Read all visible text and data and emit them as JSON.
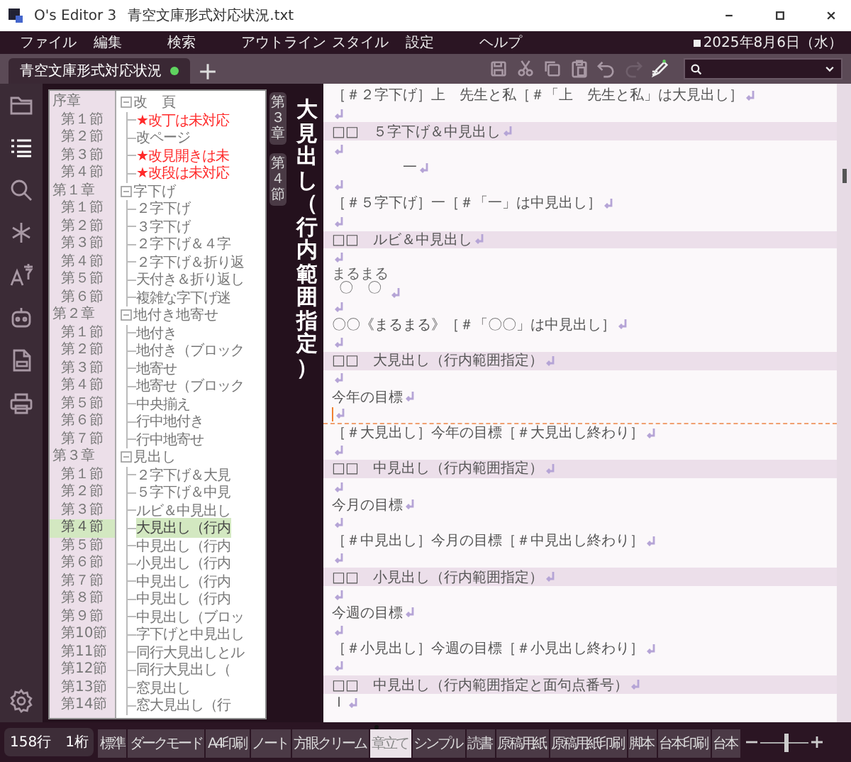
{
  "window": {
    "app": "O's Editor 3",
    "file": "青空文庫形式対応状況.txt"
  },
  "menu": [
    "ファイル",
    "編集",
    "検索",
    "アウトライン",
    "スタイル",
    "設定",
    "ヘルプ"
  ],
  "date": "2025年8月6日（水）",
  "tabs": [
    {
      "label": "青空文庫形式対応状況",
      "selected": true,
      "modified": true
    }
  ],
  "toolbar": [
    {
      "kind": "save",
      "disabled": false
    },
    {
      "kind": "cut",
      "disabled": false
    },
    {
      "kind": "copy",
      "disabled": false
    },
    {
      "kind": "paste",
      "disabled": false
    },
    {
      "kind": "undo",
      "disabled": false
    },
    {
      "kind": "redo",
      "disabled": true
    },
    {
      "kind": "pen",
      "disabled": false
    }
  ],
  "sidebar_icons": [
    {
      "kind": "folder",
      "selected": false
    },
    {
      "kind": "outline",
      "selected": true
    },
    {
      "kind": "search",
      "selected": false
    },
    {
      "kind": "asterisk",
      "selected": false
    },
    {
      "kind": "font",
      "selected": false
    },
    {
      "kind": "robot",
      "selected": false
    },
    {
      "kind": "document",
      "selected": false
    },
    {
      "kind": "printer",
      "selected": false
    },
    {
      "kind": "settings",
      "selected": false
    }
  ],
  "outline": {
    "chapters": [
      {
        "label": "序章",
        "kind": "chapter",
        "selected": false
      },
      {
        "label": "第１節",
        "kind": "section",
        "selected": false
      },
      {
        "label": "第２節",
        "kind": "section",
        "selected": false
      },
      {
        "label": "第３節",
        "kind": "section",
        "selected": false
      },
      {
        "label": "第４節",
        "kind": "section",
        "selected": false
      },
      {
        "label": "第１章",
        "kind": "chapter",
        "selected": false
      },
      {
        "label": "第１節",
        "kind": "section",
        "selected": false
      },
      {
        "label": "第２節",
        "kind": "section",
        "selected": false
      },
      {
        "label": "第３節",
        "kind": "section",
        "selected": false
      },
      {
        "label": "第４節",
        "kind": "section",
        "selected": false
      },
      {
        "label": "第５節",
        "kind": "section",
        "selected": false
      },
      {
        "label": "第６節",
        "kind": "section",
        "selected": false
      },
      {
        "label": "第２章",
        "kind": "chapter",
        "selected": false
      },
      {
        "label": "第１節",
        "kind": "section",
        "selected": false
      },
      {
        "label": "第２節",
        "kind": "section",
        "selected": false
      },
      {
        "label": "第３節",
        "kind": "section",
        "selected": false
      },
      {
        "label": "第４節",
        "kind": "section",
        "selected": false
      },
      {
        "label": "第５節",
        "kind": "section",
        "selected": false
      },
      {
        "label": "第６節",
        "kind": "section",
        "selected": false
      },
      {
        "label": "第７節",
        "kind": "section",
        "selected": false
      },
      {
        "label": "第３章",
        "kind": "chapter",
        "selected": false
      },
      {
        "label": "第１節",
        "kind": "section",
        "selected": false
      },
      {
        "label": "第２節",
        "kind": "section",
        "selected": false
      },
      {
        "label": "第３節",
        "kind": "section",
        "selected": false
      },
      {
        "label": "第４節",
        "kind": "section",
        "selected": true
      },
      {
        "label": "第５節",
        "kind": "section",
        "selected": false
      },
      {
        "label": "第６節",
        "kind": "section",
        "selected": false
      },
      {
        "label": "第７節",
        "kind": "section",
        "selected": false
      },
      {
        "label": "第８節",
        "kind": "section",
        "selected": false
      },
      {
        "label": "第９節",
        "kind": "section",
        "selected": false
      },
      {
        "label": "第10節",
        "kind": "section",
        "selected": false
      },
      {
        "label": "第11節",
        "kind": "section",
        "selected": false
      },
      {
        "label": "第12節",
        "kind": "section",
        "selected": false
      },
      {
        "label": "第13節",
        "kind": "section",
        "selected": false
      },
      {
        "label": "第14節",
        "kind": "section",
        "selected": false
      }
    ],
    "tree": [
      {
        "label": "改　頁",
        "expanded": true,
        "children": [
          {
            "label": "★改丁は未対応",
            "flagged": true,
            "selected": false
          },
          {
            "label": "改ページ",
            "flagged": false,
            "selected": false
          },
          {
            "label": "★改見開きは未",
            "flagged": true,
            "selected": false
          },
          {
            "label": "★改段は未対応",
            "flagged": true,
            "selected": false
          }
        ]
      },
      {
        "label": "字下げ",
        "expanded": true,
        "children": [
          {
            "label": "２字下げ",
            "flagged": false,
            "selected": false
          },
          {
            "label": "３字下げ",
            "flagged": false,
            "selected": false
          },
          {
            "label": "２字下げ＆４字",
            "flagged": false,
            "selected": false
          },
          {
            "label": "２字下げ＆折り返",
            "flagged": false,
            "selected": false
          },
          {
            "label": "天付き＆折り返し",
            "flagged": false,
            "selected": false
          },
          {
            "label": "複雑な字下げ迷",
            "flagged": false,
            "selected": false
          }
        ]
      },
      {
        "label": "地付き地寄せ",
        "expanded": true,
        "children": [
          {
            "label": "地付き",
            "flagged": false,
            "selected": false
          },
          {
            "label": "地付き（ブロック",
            "flagged": false,
            "selected": false
          },
          {
            "label": "地寄せ",
            "flagged": false,
            "selected": false
          },
          {
            "label": "地寄せ（ブロック",
            "flagged": false,
            "selected": false
          },
          {
            "label": "中央揃え",
            "flagged": false,
            "selected": false
          },
          {
            "label": "行中地付き",
            "flagged": false,
            "selected": false
          },
          {
            "label": "行中地寄せ",
            "flagged": false,
            "selected": false
          }
        ]
      },
      {
        "label": "見出し",
        "expanded": true,
        "children": [
          {
            "label": "２字下げ＆大見",
            "flagged": false,
            "selected": false
          },
          {
            "label": "５字下げ＆中見",
            "flagged": false,
            "selected": false
          },
          {
            "label": "ルビ＆中見出し",
            "flagged": false,
            "selected": false
          },
          {
            "label": "大見出し（行内",
            "flagged": false,
            "selected": true
          },
          {
            "label": "中見出し（行内",
            "flagged": false,
            "selected": false
          },
          {
            "label": "小見出し（行内",
            "flagged": false,
            "selected": false
          },
          {
            "label": "中見出し（行内",
            "flagged": false,
            "selected": false
          },
          {
            "label": "中見出し（行内",
            "flagged": false,
            "selected": false
          },
          {
            "label": "中見出し（ブロッ",
            "flagged": false,
            "selected": false
          },
          {
            "label": "字下げと中見出し",
            "flagged": false,
            "selected": false
          },
          {
            "label": "同行大見出しとル",
            "flagged": false,
            "selected": false
          },
          {
            "label": "同行大見出し（",
            "flagged": false,
            "selected": false
          },
          {
            "label": "窓見出し",
            "flagged": false,
            "selected": false
          },
          {
            "label": "窓大見出し（行",
            "flagged": false,
            "selected": false
          }
        ]
      }
    ]
  },
  "breadcrumb": [
    "第３章",
    "第４節"
  ],
  "heading": "大見出し（行内範囲指定）",
  "editor": {
    "lines": [
      {
        "kind": "plain",
        "text": "［＃２字下げ］上　先生と私［＃「上　先生と私」は大見出し］"
      },
      {
        "kind": "plain"
      },
      {
        "kind": "heading",
        "text": "□□　５字下げ＆中見出し"
      },
      {
        "kind": "plain"
      },
      {
        "kind": "plain",
        "text": "　　　　　一"
      },
      {
        "kind": "plain"
      },
      {
        "kind": "plain",
        "text": "［＃５字下げ］一［＃「一」は中見出し］"
      },
      {
        "kind": "plain"
      },
      {
        "kind": "heading",
        "text": "□□　ルビ＆中見出し"
      },
      {
        "kind": "plain"
      },
      {
        "kind": "ruby",
        "text": "〇〇",
        "ruby": "まるまる"
      },
      {
        "kind": "plain"
      },
      {
        "kind": "plain",
        "text": "〇〇《まるまる》［＃「〇〇」は中見出し］"
      },
      {
        "kind": "plain"
      },
      {
        "kind": "heading",
        "text": "□□　大見出し（行内範囲指定）"
      },
      {
        "kind": "plain"
      },
      {
        "kind": "plain",
        "text": "今年の目標"
      },
      {
        "kind": "plain",
        "current": true
      },
      {
        "kind": "plain",
        "text": "［＃大見出し］今年の目標［＃大見出し終わり］"
      },
      {
        "kind": "plain"
      },
      {
        "kind": "heading",
        "text": "□□　中見出し（行内範囲指定）"
      },
      {
        "kind": "plain"
      },
      {
        "kind": "plain",
        "text": "今月の目標"
      },
      {
        "kind": "plain"
      },
      {
        "kind": "plain",
        "text": "［＃中見出し］今月の目標［＃中見出し終わり］"
      },
      {
        "kind": "plain"
      },
      {
        "kind": "heading",
        "text": "□□　小見出し（行内範囲指定）"
      },
      {
        "kind": "plain"
      },
      {
        "kind": "plain",
        "text": "今週の目標"
      },
      {
        "kind": "plain"
      },
      {
        "kind": "plain",
        "text": "［＃小見出し］今週の目標［＃小見出し終わり］"
      },
      {
        "kind": "plain"
      },
      {
        "kind": "heading",
        "text": "□□　中見出し（行内範囲指定と面句点番号）"
      },
      {
        "kind": "plain",
        "text": "Ｉ"
      }
    ]
  },
  "status": "158行　1桁",
  "styles": [
    {
      "label": "標準",
      "selected": false
    },
    {
      "label": "ダークモード",
      "selected": false
    },
    {
      "label": "A4印刷",
      "selected": false
    },
    {
      "label": "ノート",
      "selected": false
    },
    {
      "label": "方眼クリーム",
      "selected": false
    },
    {
      "label": "章立て",
      "selected": true
    },
    {
      "label": "シンプル",
      "selected": false
    },
    {
      "label": "読書",
      "selected": false
    },
    {
      "label": "原稿用紙",
      "selected": false
    },
    {
      "label": "原稿用紙印刷",
      "selected": false
    },
    {
      "label": "脚本",
      "selected": false
    },
    {
      "label": "台本印刷",
      "selected": false
    },
    {
      "label": "台本",
      "selected": false
    }
  ],
  "zoom": {
    "level": 0.55
  }
}
